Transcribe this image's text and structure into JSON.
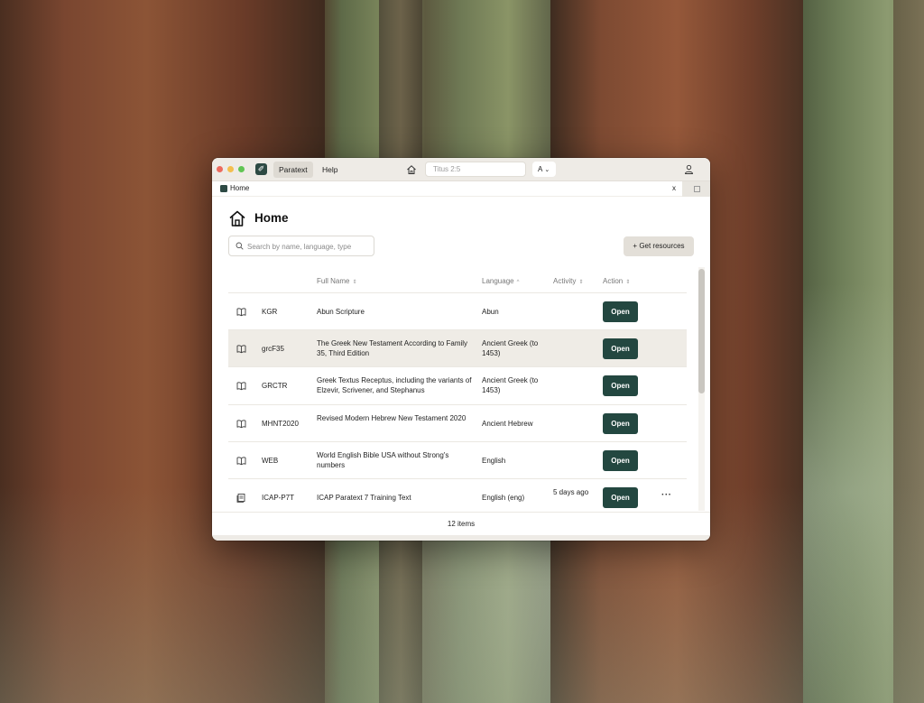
{
  "app": {
    "logo_glyph": "✐",
    "menus": [
      "Paratext",
      "Help"
    ],
    "reference_placeholder": "Titus 2:5",
    "font_selector": "A",
    "font_selector_chevron": "⌄",
    "accent_color": "#234740"
  },
  "tab": {
    "label": "Home",
    "close": "x"
  },
  "page": {
    "title": "Home",
    "search_placeholder": "Search by name, language, type",
    "get_resources_label": "+ Get resources"
  },
  "table": {
    "columns": {
      "full_name": "Full Name",
      "language": "Language",
      "activity": "Activity",
      "action": "Action"
    },
    "sort_glyphs": {
      "full_name": "⇕",
      "language": "^",
      "activity": "⇕",
      "action": "⇕"
    },
    "rows": [
      {
        "icon": "book-icon",
        "abbr": "KGR",
        "name": "Abun Scripture",
        "language": "Abun",
        "activity": "",
        "action": "Open",
        "highlight": false,
        "more": false
      },
      {
        "icon": "book-icon",
        "abbr": "grcF35",
        "name": "The Greek New Testament According to Family 35, Third Edition",
        "language": "Ancient Greek (to 1453)",
        "activity": "",
        "action": "Open",
        "highlight": true,
        "more": false
      },
      {
        "icon": "book-icon",
        "abbr": "GRCTR",
        "name": "Greek Textus Receptus, including the variants of Elzevir, Scrivener, and Stephanus",
        "language": "Ancient Greek (to 1453)",
        "activity": "",
        "action": "Open",
        "highlight": false,
        "more": false
      },
      {
        "icon": "book-icon",
        "abbr": "MHNT2020",
        "name": "Revised Modern Hebrew New Testament 2020",
        "language": "Ancient Hebrew",
        "activity": "",
        "action": "Open",
        "highlight": false,
        "more": false
      },
      {
        "icon": "book-icon",
        "abbr": "WEB",
        "name": "World English Bible USA without Strong's numbers",
        "language": "English",
        "activity": "",
        "action": "Open",
        "highlight": false,
        "more": false
      },
      {
        "icon": "project-icon",
        "abbr": "ICAP-P7T",
        "name": "ICAP Paratext 7 Training Text",
        "language": "English (eng)",
        "activity": "5 days ago",
        "action": "Open",
        "highlight": false,
        "more": true
      }
    ],
    "more_glyph": "···"
  },
  "footer": {
    "count_label": "12 items"
  }
}
